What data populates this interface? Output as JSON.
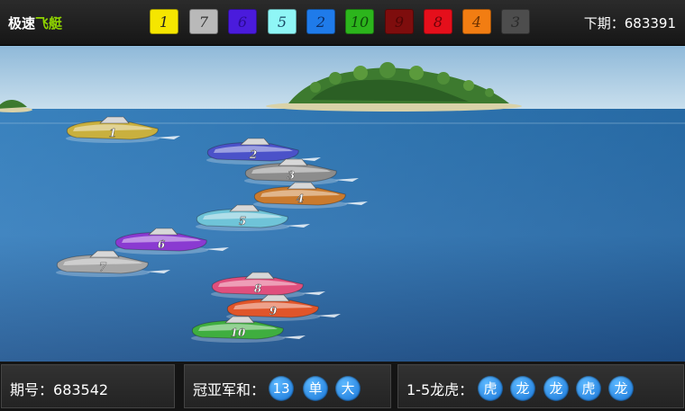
{
  "header": {
    "title_part1": "极速",
    "title_part2": "飞艇",
    "next_issue_label": "下期：",
    "next_issue_number": "683391",
    "rank_chips": [
      {
        "label": "1",
        "bg": "#f5e600",
        "color": "#222"
      },
      {
        "label": "7",
        "bg": "#b9b9b9",
        "color": "#333"
      },
      {
        "label": "6",
        "bg": "#4a1bdc",
        "color": "#2a0b8f"
      },
      {
        "label": "5",
        "bg": "#8ff6f6",
        "color": "#1b4a66"
      },
      {
        "label": "2",
        "bg": "#1f7bea",
        "color": "#0c2e66"
      },
      {
        "label": "10",
        "bg": "#2cb51c",
        "color": "#0e4a0a"
      },
      {
        "label": "9",
        "bg": "#7e0d0d",
        "color": "#4e0505"
      },
      {
        "label": "8",
        "bg": "#e50f1b",
        "color": "#6e0208"
      },
      {
        "label": "4",
        "bg": "#f27d12",
        "color": "#6d3200"
      },
      {
        "label": "3",
        "bg": "#4d4d4d",
        "color": "#2a2a2a"
      }
    ]
  },
  "race": {
    "boats": [
      {
        "number": "1",
        "color": "#c9b03e"
      },
      {
        "number": "2",
        "color": "#4b52c9"
      },
      {
        "number": "3",
        "color": "#8c8c8c"
      },
      {
        "number": "4",
        "color": "#c97a2e"
      },
      {
        "number": "5",
        "color": "#6fc4d8"
      },
      {
        "number": "6",
        "color": "#8a3ad1"
      },
      {
        "number": "7",
        "color": "#a7a7a7"
      },
      {
        "number": "8",
        "color": "#e04f7d"
      },
      {
        "number": "9",
        "color": "#e0552a"
      },
      {
        "number": "10",
        "color": "#3fae3f"
      }
    ]
  },
  "footer": {
    "issue_label": "期号：",
    "issue_number": "683542",
    "sum_label": "冠亚军和：",
    "sum_balls": [
      "13",
      "单",
      "大"
    ],
    "dragon_tiger_label": "1-5龙虎：",
    "dragon_tiger_balls": [
      "虎",
      "龙",
      "龙",
      "虎",
      "龙"
    ]
  }
}
